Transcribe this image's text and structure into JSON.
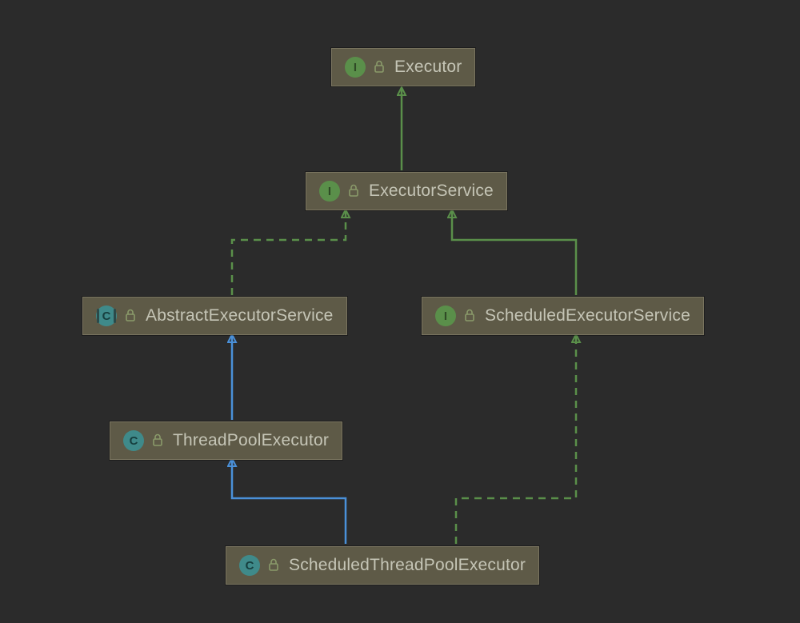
{
  "diagram": {
    "nodes": {
      "executor": {
        "label": "Executor",
        "kind": "interface",
        "badge": "I"
      },
      "executorService": {
        "label": "ExecutorService",
        "kind": "interface",
        "badge": "I"
      },
      "abstractExecutorService": {
        "label": "AbstractExecutorService",
        "kind": "abstract",
        "badge": "C"
      },
      "scheduledExecutorService": {
        "label": "ScheduledExecutorService",
        "kind": "interface",
        "badge": "I"
      },
      "threadPoolExecutor": {
        "label": "ThreadPoolExecutor",
        "kind": "class",
        "badge": "C"
      },
      "scheduledThreadPoolExecutor": {
        "label": "ScheduledThreadPoolExecutor",
        "kind": "class",
        "badge": "C"
      }
    },
    "edges": [
      {
        "from": "executorService",
        "to": "executor",
        "style": "solid",
        "color": "green"
      },
      {
        "from": "abstractExecutorService",
        "to": "executorService",
        "style": "dashed",
        "color": "green"
      },
      {
        "from": "scheduledExecutorService",
        "to": "executorService",
        "style": "solid",
        "color": "green"
      },
      {
        "from": "threadPoolExecutor",
        "to": "abstractExecutorService",
        "style": "solid",
        "color": "blue"
      },
      {
        "from": "scheduledThreadPoolExecutor",
        "to": "threadPoolExecutor",
        "style": "solid",
        "color": "blue"
      },
      {
        "from": "scheduledThreadPoolExecutor",
        "to": "scheduledExecutorService",
        "style": "dashed",
        "color": "green"
      }
    ],
    "colors": {
      "green": "#5a8f4a",
      "blue": "#4a90d9",
      "nodeBg": "#5e5a47",
      "text": "#c5c5b6",
      "bg": "#2b2b2b"
    }
  }
}
